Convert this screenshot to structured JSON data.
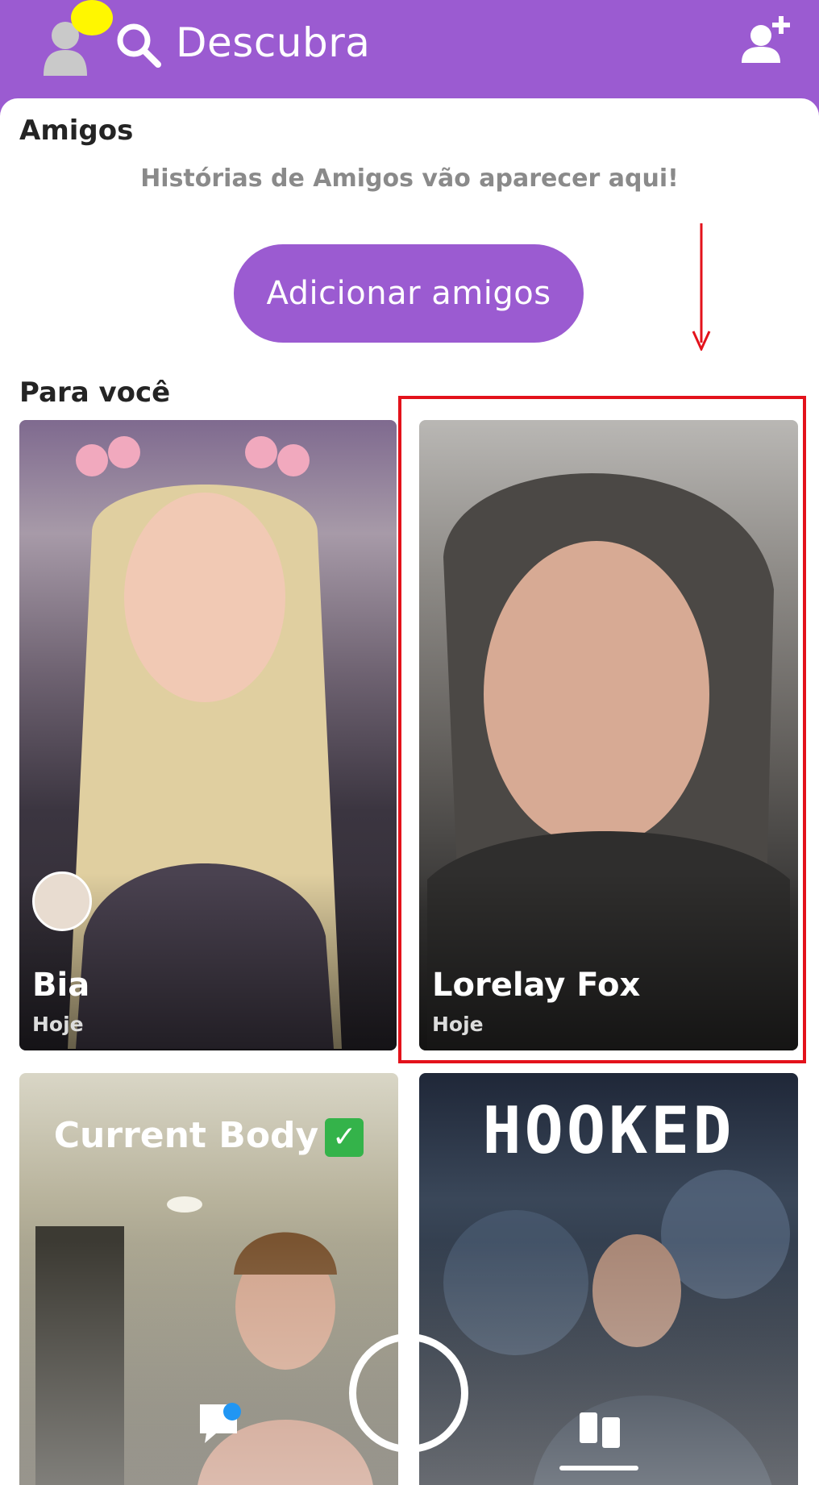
{
  "header": {
    "title": "Descubra",
    "colors": {
      "brand": "#9b5bd1",
      "notification": "#fff700"
    },
    "icons": [
      "avatar-icon",
      "search-icon",
      "add-friend-icon"
    ]
  },
  "friends": {
    "section_title": "Amigos",
    "empty_message": "Histórias de Amigos vão aparecer aqui!",
    "add_button_label": "Adicionar amigos"
  },
  "for_you": {
    "section_title": "Para você",
    "cards": [
      {
        "name": "Bia",
        "time": "Hoje"
      },
      {
        "name": "Lorelay Fox",
        "time": "Hoje"
      },
      {
        "overlay_title": "Current Body",
        "badge": "✓"
      },
      {
        "overlay_title": "HOOKED"
      }
    ]
  },
  "bottom_nav": {
    "icons": [
      "chat-icon",
      "capture-button",
      "discover-icon"
    ],
    "colors": {
      "chat_badge": "#2196f3"
    }
  },
  "annotation": {
    "color": "#e3121b"
  }
}
